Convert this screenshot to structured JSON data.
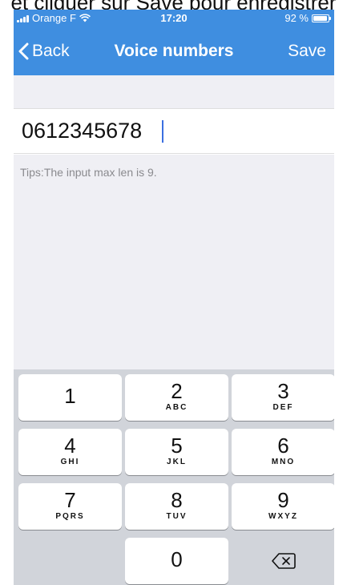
{
  "caption": {
    "before": "et cliquer sur ",
    "link": "Save",
    "after": " pour enregistrer"
  },
  "status": {
    "carrier": "Orange F",
    "time": "17:20",
    "battery": "92 %",
    "battery_level": 0.92
  },
  "nav": {
    "back_label": "Back",
    "title": "Voice numbers",
    "save_label": "Save"
  },
  "input": {
    "value": "0612345678"
  },
  "tips": "Tips:The input max len is 9.",
  "keypad": [
    {
      "num": "1",
      "letters": ""
    },
    {
      "num": "2",
      "letters": "ABC"
    },
    {
      "num": "3",
      "letters": "DEF"
    },
    {
      "num": "4",
      "letters": "GHI"
    },
    {
      "num": "5",
      "letters": "JKL"
    },
    {
      "num": "6",
      "letters": "MNO"
    },
    {
      "num": "7",
      "letters": "PQRS"
    },
    {
      "num": "8",
      "letters": "TUV"
    },
    {
      "num": "9",
      "letters": "WXYZ"
    },
    {
      "num": "0",
      "letters": ""
    }
  ],
  "colors": {
    "accent": "#3f8ee0",
    "caret": "#3b6fe0",
    "keyboard_bg": "#d1d4da"
  }
}
